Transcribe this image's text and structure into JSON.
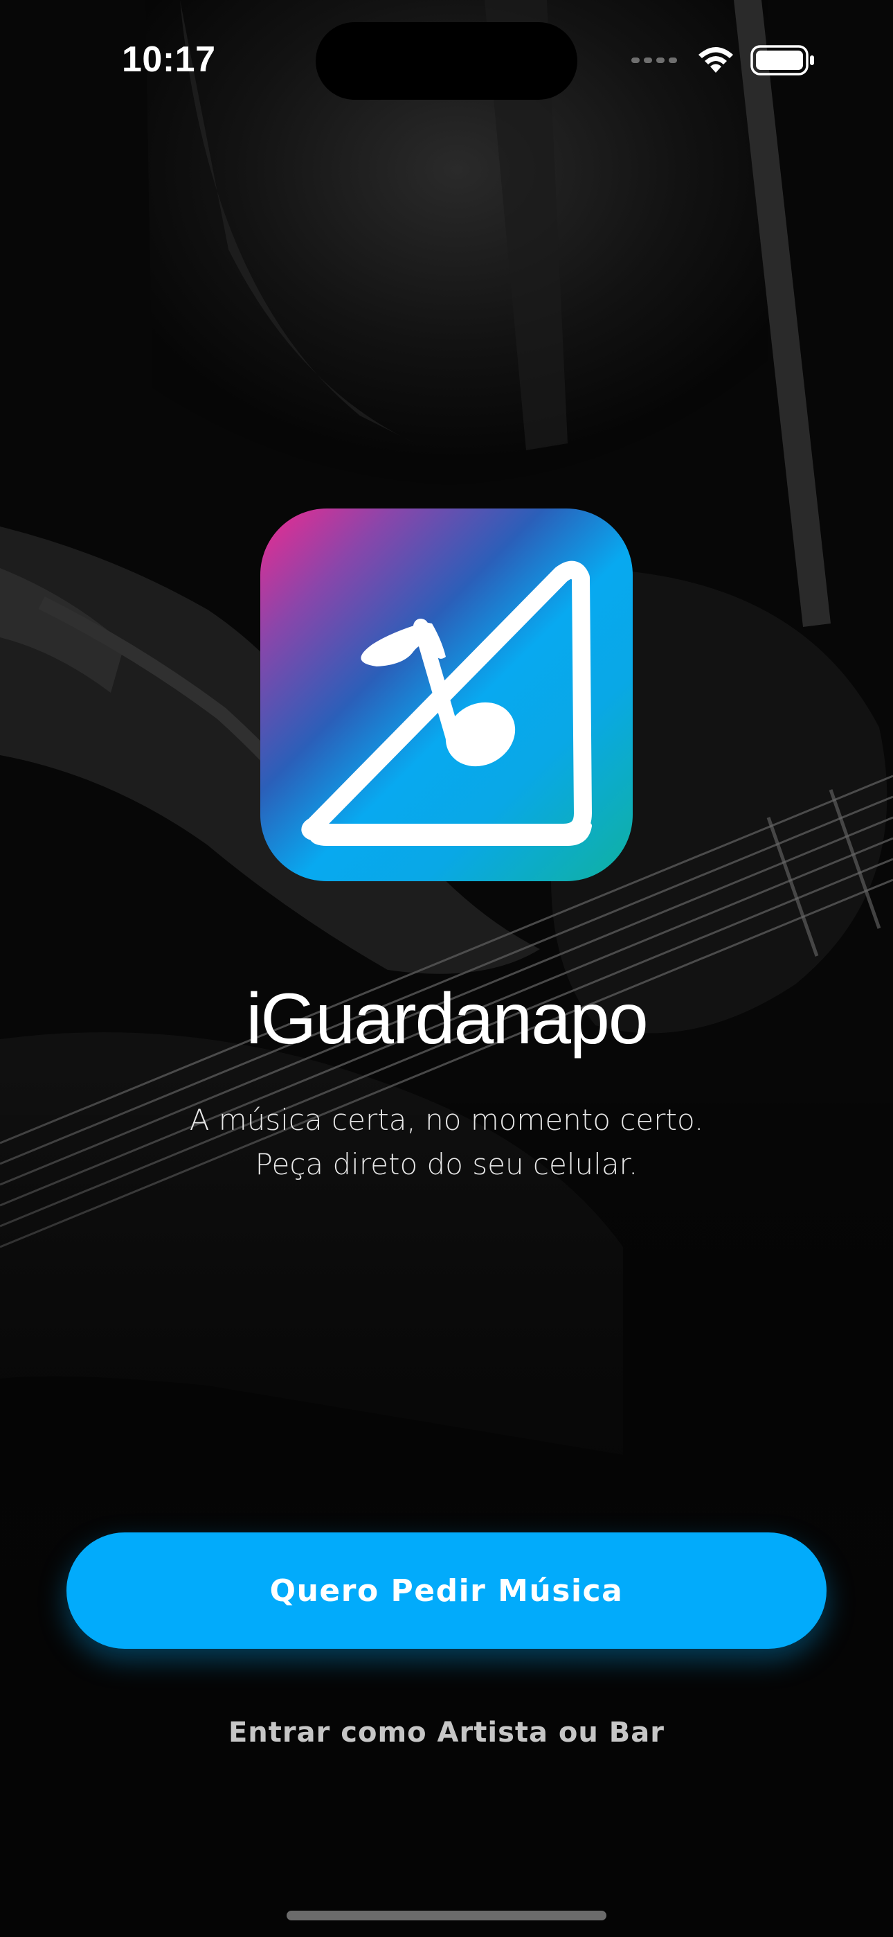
{
  "status_bar": {
    "time": "10:17",
    "icons": [
      "cellular-dots-icon",
      "wifi-icon",
      "battery-icon"
    ]
  },
  "app": {
    "name": "iGuardanapo",
    "icon_name": "napkin-music-note-icon",
    "tagline_line1": "A música certa, no momento certo.",
    "tagline_line2": "Peça direto do seu celular."
  },
  "actions": {
    "primary_label": "Quero Pedir Música",
    "secondary_label": "Entrar como Artista ou Bar"
  },
  "colors": {
    "background": "#000000",
    "primary_button": "#02ABFB",
    "text": "#FFFFFF",
    "secondary_text": "#C6C6C6"
  }
}
